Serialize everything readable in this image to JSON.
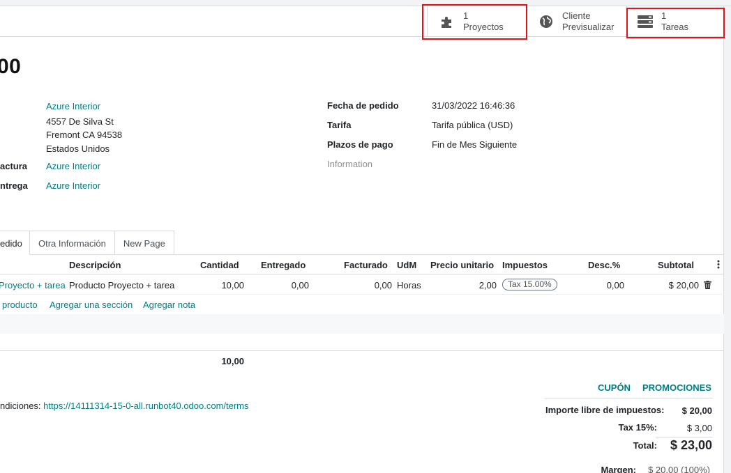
{
  "smart_buttons": {
    "projects": {
      "count": "1",
      "label": "Proyectos"
    },
    "customer": {
      "line1": "Cliente",
      "line2": "Previsualizar"
    },
    "tasks": {
      "count": "1",
      "label": "Tareas"
    }
  },
  "title": "00",
  "customer": {
    "name": "Azure Interior",
    "address_line1": "4557 De Silva St",
    "address_line2": "Fremont CA 94538",
    "address_line3": "Estados Unidos",
    "invoice_label": "actura",
    "invoice_value": "Azure Interior",
    "delivery_label": "ntrega",
    "delivery_value": "Azure Interior"
  },
  "order_info": {
    "date_label": "Fecha de pedido",
    "date_value": "31/03/2022 16:46:36",
    "pricelist_label": "Tarifa",
    "pricelist_value": "Tarifa pública (USD)",
    "terms_label": "Plazos de pago",
    "terms_value": "Fin de Mes Siguiente",
    "info_placeholder": "Information"
  },
  "tabs": [
    "edido",
    "Otra Información",
    "New Page"
  ],
  "table": {
    "headers": {
      "description": "Descripción",
      "quantity": "Cantidad",
      "delivered": "Entregado",
      "invoiced": "Facturado",
      "uom": "UdM",
      "unit_price": "Precio unitario",
      "taxes": "Impuestos",
      "discount": "Desc.%",
      "subtotal": "Subtotal"
    },
    "row": {
      "product": "Proyecto + tarea",
      "description": "Producto Proyecto + tarea",
      "quantity": "10,00",
      "delivered": "0,00",
      "invoiced": "0,00",
      "uom": "Horas",
      "unit_price": "2,00",
      "tax": "Tax 15.00%",
      "discount": "0,00",
      "subtotal": "$ 20,00"
    },
    "add_product": "producto",
    "add_section": "Agregar una sección",
    "add_note": "Agregar nota",
    "total_quantity": "10,00"
  },
  "terms": {
    "prefix": "ndiciones: ",
    "url": "https://14111314-15-0-all.runbot40.odoo.com/terms"
  },
  "totals": {
    "coupon": "CUPÓN",
    "promotions": "PROMOCIONES",
    "untaxed_label": "Importe libre de impuestos:",
    "untaxed_value": "$ 20,00",
    "tax_label": "Tax 15%:",
    "tax_value": "$ 3,00",
    "total_label": "Total:",
    "total_value": "$ 23,00",
    "margin_label": "Margen:",
    "margin_value": "$ 20,00 (100%)"
  },
  "colors": {
    "accent": "#017e84",
    "highlight": "#e3111a"
  }
}
